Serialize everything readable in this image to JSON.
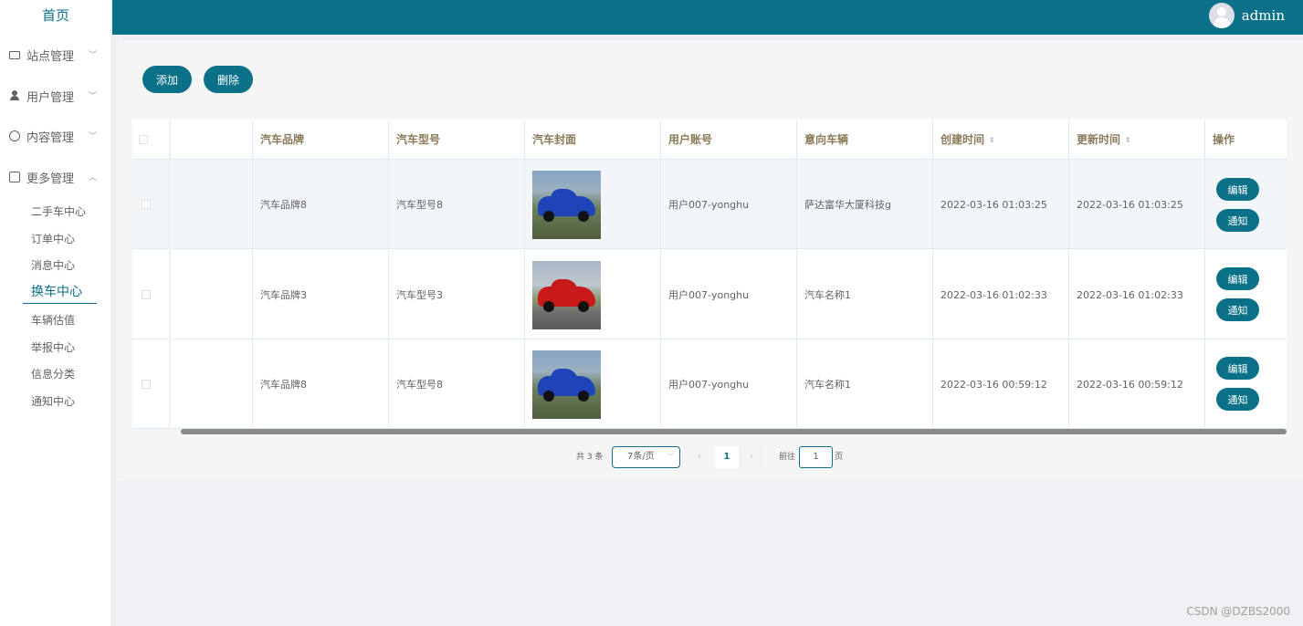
{
  "sidebar": {
    "home": "首页",
    "menus": [
      {
        "label": "站点管理",
        "icon": "monitor-icon",
        "arrow": "﹀"
      },
      {
        "label": "用户管理",
        "icon": "user-icon",
        "arrow": "﹀"
      },
      {
        "label": "内容管理",
        "icon": "chat-icon",
        "arrow": "﹀"
      },
      {
        "label": "更多管理",
        "icon": "copy-icon",
        "arrow": "︿"
      }
    ],
    "submenu": [
      "二手车中心",
      "订单中心",
      "消息中心",
      "换车中心",
      "车辆估值",
      "举报中心",
      "信息分类",
      "通知中心"
    ],
    "active_submenu": "换车中心"
  },
  "header": {
    "username": "admin",
    "color": "#0b7189"
  },
  "toolbar": {
    "add_label": "添加",
    "delete_label": "删除"
  },
  "table": {
    "columns": [
      "汽车品牌",
      "汽车型号",
      "汽车封面",
      "用户账号",
      "意向车辆",
      "创建时间",
      "更新时间",
      "操作"
    ],
    "sort_icon": "⇕",
    "rows": [
      {
        "brand": "汽车品牌8",
        "model": "汽车型号8",
        "cover": "blue-car",
        "account": "用户007-yonghu",
        "intent": "萨达富华大厦科技g",
        "created": "2022-03-16 01:03:25",
        "updated": "2022-03-16 01:03:25"
      },
      {
        "brand": "汽车品牌3",
        "model": "汽车型号3",
        "cover": "red-car",
        "account": "用户007-yonghu",
        "intent": "汽车名称1",
        "created": "2022-03-16 01:02:33",
        "updated": "2022-03-16 01:02:33"
      },
      {
        "brand": "汽车品牌8",
        "model": "汽车型号8",
        "cover": "blue-car",
        "account": "用户007-yonghu",
        "intent": "汽车名称1",
        "created": "2022-03-16 00:59:12",
        "updated": "2022-03-16 00:59:12"
      }
    ],
    "edit_label": "编辑",
    "notify_label": "通知"
  },
  "pagination": {
    "total": "共 3 条",
    "page_size": "7条/页",
    "prev": "‹",
    "next": "›",
    "current": "1",
    "goto_label": "前往",
    "goto_value": "1",
    "unit": "页"
  },
  "watermark": "CSDN @DZBS2000"
}
